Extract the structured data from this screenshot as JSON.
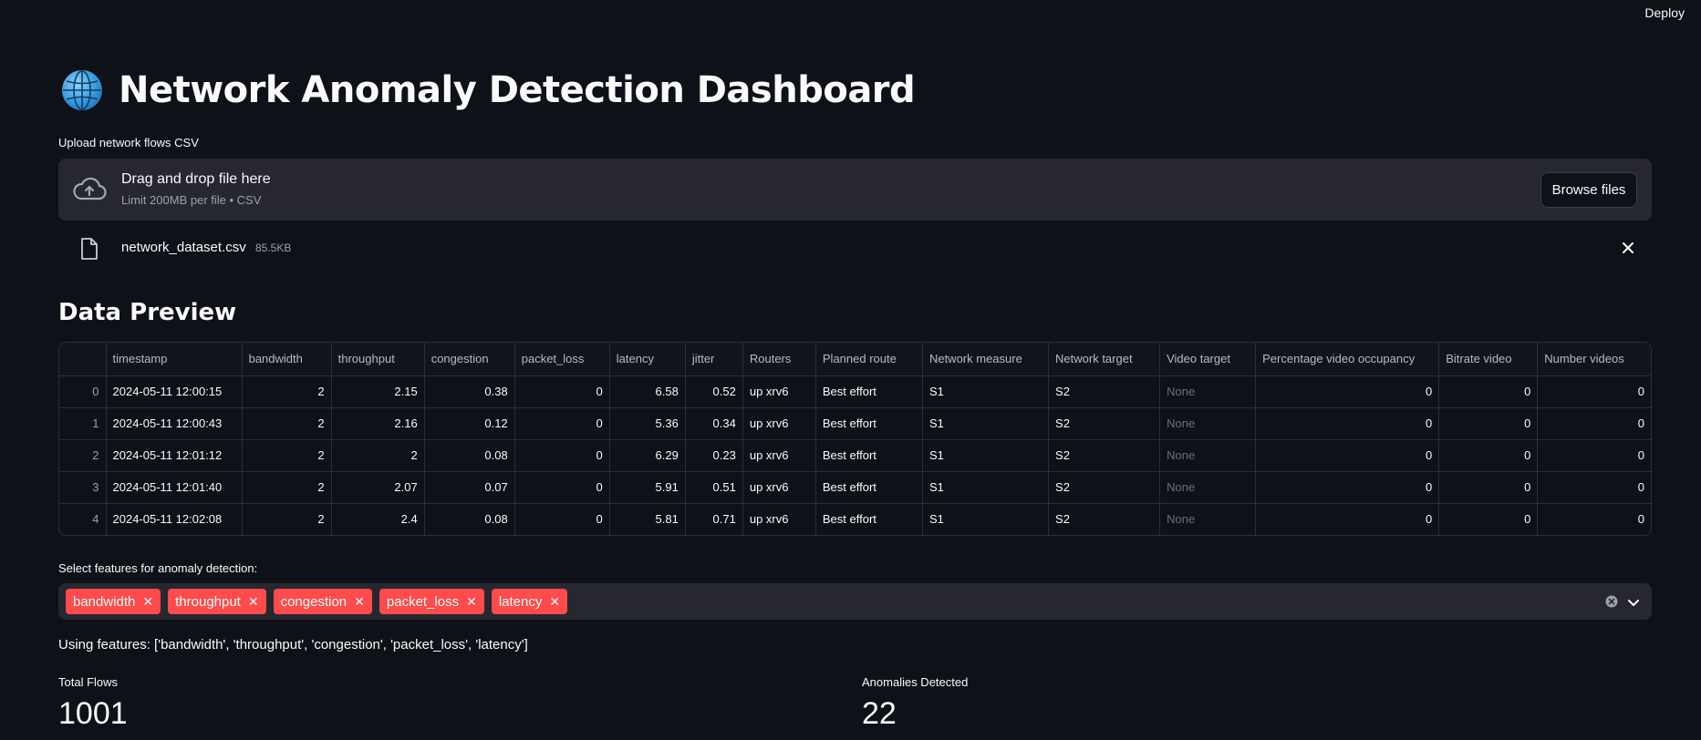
{
  "topbar": {
    "deploy_label": "Deploy"
  },
  "header": {
    "title": "Network Anomaly Detection Dashboard",
    "icon": "globe-icon"
  },
  "uploader": {
    "label": "Upload network flows CSV",
    "drop_text": "Drag and drop file here",
    "limit_text": "Limit 200MB per file • CSV",
    "browse_label": "Browse files",
    "file": {
      "name": "network_dataset.csv",
      "size": "85.5KB"
    }
  },
  "preview": {
    "title": "Data Preview",
    "columns": [
      "",
      "timestamp",
      "bandwidth",
      "throughput",
      "congestion",
      "packet_loss",
      "latency",
      "jitter",
      "Routers",
      "Planned route",
      "Network measure",
      "Network target",
      "Video target",
      "Percentage video occupancy",
      "Bitrate video",
      "Number videos"
    ],
    "rows": [
      [
        "0",
        "2024-05-11 12:00:15",
        "2",
        "2.15",
        "0.38",
        "0",
        "6.58",
        "0.52",
        "up xrv6",
        "Best effort",
        "S1",
        "S2",
        "None",
        "0",
        "0",
        "0"
      ],
      [
        "1",
        "2024-05-11 12:00:43",
        "2",
        "2.16",
        "0.12",
        "0",
        "5.36",
        "0.34",
        "up xrv6",
        "Best effort",
        "S1",
        "S2",
        "None",
        "0",
        "0",
        "0"
      ],
      [
        "2",
        "2024-05-11 12:01:12",
        "2",
        "2",
        "0.08",
        "0",
        "6.29",
        "0.23",
        "up xrv6",
        "Best effort",
        "S1",
        "S2",
        "None",
        "0",
        "0",
        "0"
      ],
      [
        "3",
        "2024-05-11 12:01:40",
        "2",
        "2.07",
        "0.07",
        "0",
        "5.91",
        "0.51",
        "up xrv6",
        "Best effort",
        "S1",
        "S2",
        "None",
        "0",
        "0",
        "0"
      ],
      [
        "4",
        "2024-05-11 12:02:08",
        "2",
        "2.4",
        "0.08",
        "0",
        "5.81",
        "0.71",
        "up xrv6",
        "Best effort",
        "S1",
        "S2",
        "None",
        "0",
        "0",
        "0"
      ]
    ]
  },
  "features": {
    "label": "Select features for anomaly detection:",
    "selected": [
      "bandwidth",
      "throughput",
      "congestion",
      "packet_loss",
      "latency"
    ],
    "chip_color": "#ff4b4b",
    "using_text": "Using features: ['bandwidth', 'throughput', 'congestion', 'packet_loss', 'latency']"
  },
  "metrics": {
    "total_label": "Total Flows",
    "total_value": "1001",
    "anomalies_label": "Anomalies Detected",
    "anomalies_value": "22"
  }
}
